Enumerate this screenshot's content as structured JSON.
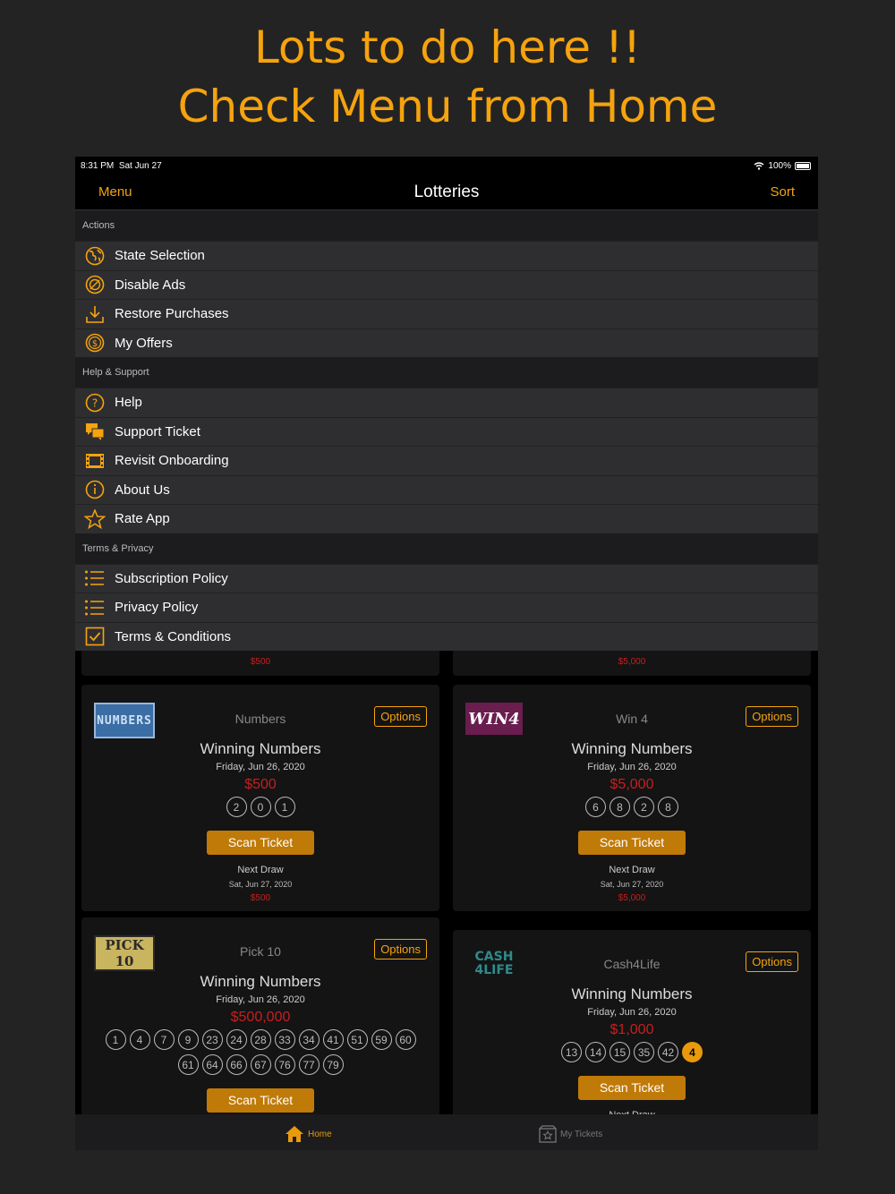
{
  "headline": {
    "line1": "Lots to do here !!",
    "line2": "Check Menu from Home"
  },
  "status": {
    "time": "8:31 PM",
    "date": "Sat Jun 27",
    "battery": "100%"
  },
  "nav": {
    "menu": "Menu",
    "title": "Lotteries",
    "sort": "Sort"
  },
  "menu": {
    "sections": [
      {
        "header": "Actions",
        "items": [
          {
            "label": "State Selection",
            "icon": "globe-icon"
          },
          {
            "label": "Disable Ads",
            "icon": "no-ads-icon"
          },
          {
            "label": "Restore Purchases",
            "icon": "download-icon"
          },
          {
            "label": "My Offers",
            "icon": "dollar-icon"
          }
        ]
      },
      {
        "header": "Help & Support",
        "items": [
          {
            "label": "Help",
            "icon": "question-icon"
          },
          {
            "label": "Support Ticket",
            "icon": "chat-icon"
          },
          {
            "label": "Revisit Onboarding",
            "icon": "film-icon"
          },
          {
            "label": "About Us",
            "icon": "info-icon"
          },
          {
            "label": "Rate App",
            "icon": "star-icon"
          }
        ]
      },
      {
        "header": "Terms & Privacy",
        "items": [
          {
            "label": "Subscription Policy",
            "icon": "list-icon"
          },
          {
            "label": "Privacy Policy",
            "icon": "list-icon"
          },
          {
            "label": "Terms & Conditions",
            "icon": "checkbox-icon"
          }
        ]
      }
    ]
  },
  "partial": {
    "left_prize": "$500",
    "right_prize": "$5,000"
  },
  "cards": [
    {
      "logo": "NUMBERS",
      "name": "Numbers",
      "options": "Options",
      "winning": "Winning Numbers",
      "date": "Friday, Jun 26, 2020",
      "prize": "$500",
      "balls": [
        [
          "2",
          "0",
          "1"
        ]
      ],
      "scan": "Scan Ticket",
      "next": "Next Draw",
      "next_date": "Sat, Jun 27, 2020",
      "next_prize": "$500"
    },
    {
      "logo": "WIN4",
      "name": "Win 4",
      "options": "Options",
      "winning": "Winning Numbers",
      "date": "Friday, Jun 26, 2020",
      "prize": "$5,000",
      "balls": [
        [
          "6",
          "8",
          "2",
          "8"
        ]
      ],
      "scan": "Scan Ticket",
      "next": "Next Draw",
      "next_date": "Sat, Jun 27, 2020",
      "next_prize": "$5,000"
    },
    {
      "logo": "PICK 10",
      "name": "Pick 10",
      "options": "Options",
      "winning": "Winning Numbers",
      "date": "Friday, Jun 26, 2020",
      "prize": "$500,000",
      "balls": [
        [
          "1",
          "4",
          "7",
          "9",
          "23",
          "24",
          "28",
          "33",
          "34",
          "41",
          "51",
          "59",
          "60"
        ],
        [
          "61",
          "64",
          "66",
          "67",
          "76",
          "77",
          "79"
        ]
      ],
      "scan": "Scan Ticket"
    },
    {
      "logo": "CASH 4LIFE",
      "name": "Cash4Life",
      "options": "Options",
      "winning": "Winning Numbers",
      "date": "Friday, Jun 26, 2020",
      "prize": "$1,000",
      "balls": [
        [
          "13",
          "14",
          "15",
          "35",
          "42"
        ]
      ],
      "bonus": "4",
      "scan": "Scan Ticket",
      "next": "Next Draw"
    }
  ],
  "tabs": {
    "home": "Home",
    "tickets": "My Tickets"
  },
  "colors": {
    "accent": "#f5a30e",
    "prize": "#c81e1e",
    "scan": "#c07a08"
  }
}
